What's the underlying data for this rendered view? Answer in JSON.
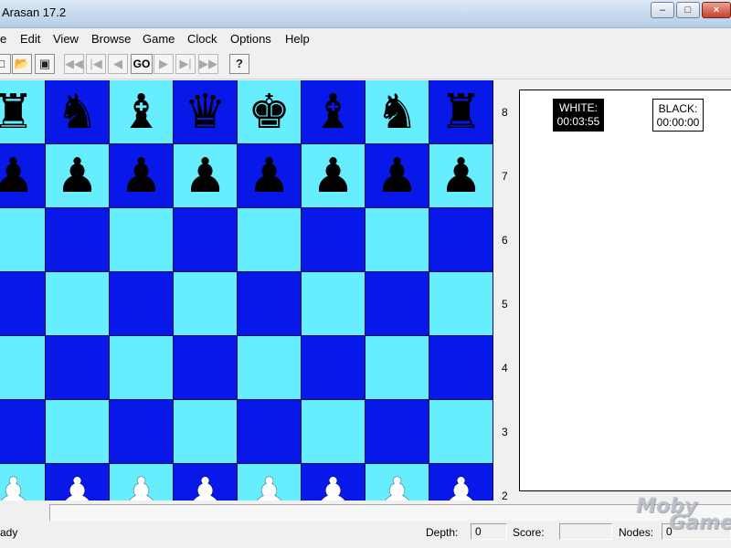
{
  "window": {
    "title": "Arasan 17.2",
    "minimize": "–",
    "maximize": "□",
    "close": "×"
  },
  "menu": [
    "e",
    "Edit",
    "View",
    "Browse",
    "Game",
    "Clock",
    "Options",
    "Help"
  ],
  "toolbar": {
    "icons": [
      "new-icon",
      "open-icon",
      "save-icon",
      "first-move-icon",
      "back-move-icon",
      "step-back-icon",
      "step-forward-icon",
      "forward-move-icon",
      "last-move-icon",
      "help-icon"
    ],
    "go_label": "GO",
    "help_label": "?"
  },
  "board": {
    "ranks": [
      "8",
      "7",
      "6",
      "5",
      "4",
      "3",
      "2"
    ],
    "rows": [
      [
        "r",
        "n",
        "b",
        "q",
        "k",
        "b",
        "n",
        "r"
      ],
      [
        "p",
        "p",
        "p",
        "p",
        "p",
        "p",
        "p",
        "p"
      ],
      [
        "",
        "",
        "",
        "",
        "",
        "",
        "",
        ""
      ],
      [
        "",
        "",
        "",
        "",
        "",
        "",
        "",
        ""
      ],
      [
        "",
        "",
        "",
        "",
        "",
        "",
        "",
        ""
      ],
      [
        "",
        "",
        "",
        "",
        "",
        "",
        "",
        ""
      ],
      [
        "P",
        "P",
        "P",
        "P",
        "P",
        "P",
        "P",
        "P"
      ]
    ],
    "colors": {
      "light": "#66eeff",
      "dark": "#0818e8"
    }
  },
  "clocks": {
    "white": {
      "label": "WHITE:",
      "time": "00:03:55"
    },
    "black": {
      "label": "BLACK:",
      "time": "00:00:00"
    }
  },
  "status": {
    "text": "ady",
    "depth_label": "Depth:",
    "depth_value": "0",
    "score_label": "Score:",
    "score_value": "",
    "nodes_label": "Nodes:",
    "nodes_value": "0"
  },
  "watermark": {
    "line1": "Moby",
    "line2": "Games"
  }
}
